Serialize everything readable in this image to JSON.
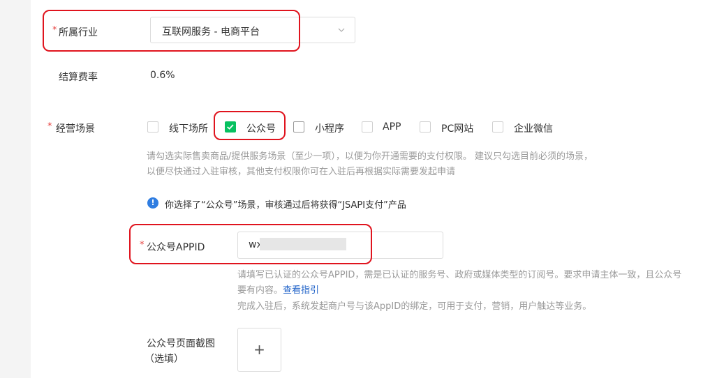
{
  "industry": {
    "label": "所属行业",
    "required_mark": "*",
    "selected": "互联网服务 - 电商平台"
  },
  "rate": {
    "label": "结算费率",
    "value": "0.6%"
  },
  "scenes": {
    "label": "经营场景",
    "required_mark": "*",
    "options": [
      {
        "label": "线下场所",
        "checked": false
      },
      {
        "label": "公众号",
        "checked": true
      },
      {
        "label": "小程序",
        "checked": false
      },
      {
        "label": "APP",
        "checked": false
      },
      {
        "label": "PC网站",
        "checked": false
      },
      {
        "label": "企业微信",
        "checked": false
      }
    ],
    "hint_line1": "请勾选实际售卖商品/提供服务场景（至少一项），以便为你开通需要的支付权限。 建议只勾选目前必须的场景，",
    "hint_line2": "以便尽快通过入驻审核，其他支付权限你可在入驻后再根据实际需要发起申请",
    "info_icon": "info-icon",
    "info_text": "你选择了“公众号”场景，审核通过后将获得“JSAPI支付”产品"
  },
  "appid": {
    "label": "公众号APPID",
    "required_mark": "*",
    "value": "wx",
    "hint_line1": "请填写已认证的公众号APPID，需是已认证的服务号、政府或媒体类型的订阅号。要求申请主体一致，且公众号",
    "hint_line2_prefix": "要有内容。",
    "hint_link": "查看指引",
    "hint_line3": "完成入驻后，系统发起商户号与该AppID的绑定，可用于支付，营销，用户触达等业务。"
  },
  "screenshot": {
    "label_line1": "公众号页面截图",
    "label_line2": "（选填）",
    "upload_symbol": "+"
  },
  "colors": {
    "accent_green": "#07c160",
    "highlight_red": "#e0141e",
    "info_blue": "#2f7de1",
    "link_blue": "#1f62c8"
  }
}
